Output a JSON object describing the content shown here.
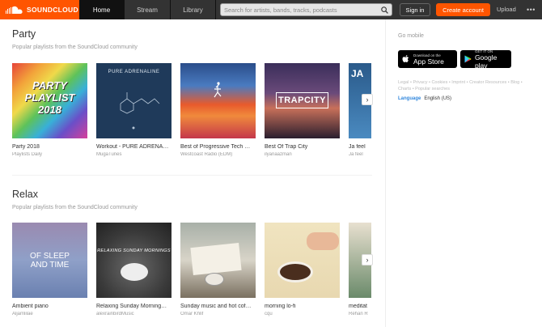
{
  "header": {
    "logo": "SOUNDCLOUD",
    "nav": [
      "Home",
      "Stream",
      "Library"
    ],
    "search_placeholder": "Search for artists, bands, tracks, podcasts",
    "signin": "Sign in",
    "create_account": "Create account",
    "upload": "Upload",
    "more": "•••"
  },
  "sections": [
    {
      "title": "Party",
      "subtitle": "Popular playlists from the SoundCloud community",
      "tiles": [
        {
          "title": "Party 2018",
          "user": "Playlists Daily",
          "art_text": "PARTY PLAYLIST 2018"
        },
        {
          "title": "Workout - PURE ADRENA…",
          "user": "MugaTunes",
          "art_text": "PURE ADRENALINE"
        },
        {
          "title": "Best of Progressive Tech …",
          "user": "Westcoast Radio (EDM)",
          "art_text": ""
        },
        {
          "title": "Best Of Trap City",
          "user": "ilyanaazman",
          "art_text": "TRAPCITY"
        },
        {
          "title": "Ja feel",
          "user": "Ja feel",
          "art_text": "JA"
        }
      ]
    },
    {
      "title": "Relax",
      "subtitle": "Popular playlists from the SoundCloud community",
      "tiles": [
        {
          "title": "Ambient piano",
          "user": "Aljamlilae",
          "art_text": "OF SLEEP AND TIME"
        },
        {
          "title": "Relaxing Sunday Morning…",
          "user": "alexrainbirdMusic",
          "art_text": "RELAXING SUNDAY MORNINGS"
        },
        {
          "title": "Sunday music and hot cof…",
          "user": "Omar Khlif",
          "art_text": ""
        },
        {
          "title": "morning lo-fi",
          "user": "cqu",
          "art_text": ""
        },
        {
          "title": "meditat",
          "user": "Rehan R",
          "art_text": ""
        }
      ]
    }
  ],
  "sidebar": {
    "go_mobile": "Go mobile",
    "app_store_small": "Download on the",
    "app_store_big": "App Store",
    "google_small": "GET IT ON",
    "google_big": "Google play",
    "links": "Legal • Privacy • Cookies • Imprint • Creator Resources • Blog • Charts • Popular searches",
    "language_label": "Language",
    "language_value": "English (US)"
  },
  "colors": {
    "brand": "#ff5500",
    "header_bg": "#333333",
    "page_bg": "#f2f2f2"
  }
}
